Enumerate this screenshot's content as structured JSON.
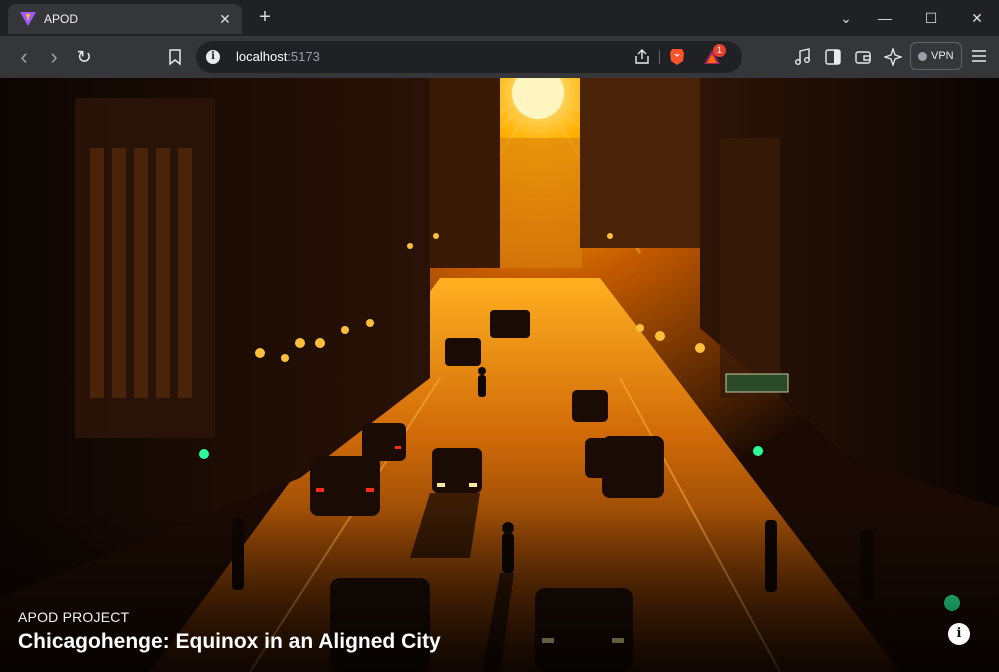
{
  "browser": {
    "tab": {
      "title": "APOD",
      "favicon": "vite-logo-icon",
      "close_glyph": "✕"
    },
    "new_tab_glyph": "+",
    "window_controls": {
      "dropdown": "⌄",
      "minimize": "—",
      "maximize": "☐",
      "close": "✕"
    },
    "toolbar": {
      "back_glyph": "‹",
      "forward_glyph": "›",
      "reload_glyph": "↻",
      "url_host": "localhost",
      "url_port": ":5173",
      "rewards_badge": "1",
      "vpn_label": "VPN"
    }
  },
  "page": {
    "subtitle": "APOD PROJECT",
    "title": "Chicagohenge: Equinox in an Aligned City",
    "info_glyph": "i"
  },
  "colors": {
    "sun": "#ffd75a",
    "sky_glow": "#ff8a00",
    "street": "#b55406",
    "shadow": "#0d0603"
  }
}
